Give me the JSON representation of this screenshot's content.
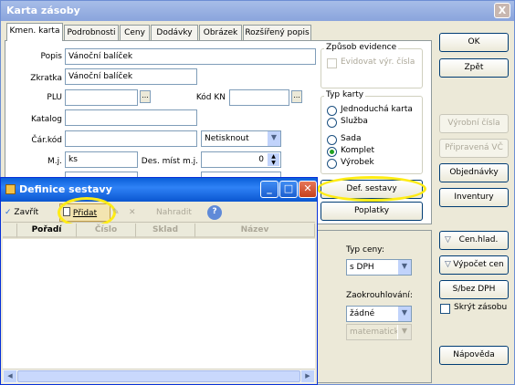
{
  "main_window": {
    "title": "Karta zásoby",
    "close": "X",
    "tabs": [
      "Kmen. karta",
      "Podrobnosti",
      "Ceny",
      "Dodávky",
      "Obrázek",
      "Rozšířený popis"
    ],
    "fields": {
      "popis_label": "Popis",
      "popis_value": "Vánoční balíček",
      "zkratka_label": "Zkratka",
      "zkratka_value": "Vánoční balíček",
      "plu_label": "PLU",
      "kod_kn_label": "Kód KN",
      "katalog_label": "Katalog",
      "car_kod_label": "Čár.kód",
      "car_kod_combo": "Netisknout",
      "mj_label": "M.j.",
      "mj_value": "ks",
      "des_mist_label": "Des. míst m.j.",
      "des_mist_value": "0",
      "ellipsis": "..."
    },
    "zpusob_evidence": {
      "title": "Způsob evidence",
      "checkbox_label": "Evidovat výr. čísla"
    },
    "typ_karty": {
      "title": "Typ karty",
      "options": [
        "Jednoduchá karta",
        "Služba",
        "Sada",
        "Komplet",
        "Výrobek"
      ],
      "selected": "Komplet"
    },
    "def_sestavy_button": "Def. sestavy",
    "poplatky_button": "Poplatky",
    "typ_ceny_label": "Typ ceny:",
    "typ_ceny_value": "s DPH",
    "zaokrouhlovani_label": "Zaokrouhlování:",
    "zaokrouhlovani_value": "žádné",
    "zaokr_mode_value": "matematicky",
    "right_buttons": {
      "ok": "OK",
      "zpet": "Zpět",
      "vyrobni_cisla": "Výrobní čísla",
      "pripravena_vc": "Připravená VČ",
      "objednavky": "Objednávky",
      "inventury": "Inventury",
      "cen_hlad": "Cen.hlad.",
      "vypocet_cen": "Výpočet cen",
      "s_bez_dph": "S/bez DPH",
      "skryt_zasobu": "Skrýt zásobu",
      "napoveda": "Nápověda"
    }
  },
  "dialog": {
    "title": "Definice sestavy",
    "toolbar": {
      "zavrit": "Zavřít",
      "pridat": "Přidat",
      "nahradit": "Nahradit",
      "help": "?"
    },
    "columns": [
      "Pořadí",
      "Číslo",
      "Sklad",
      "Název"
    ]
  },
  "colors": {
    "highlight": "#ffec14",
    "xp_blue": "#0a5fd8",
    "dialog_bg": "#ece9d8"
  }
}
